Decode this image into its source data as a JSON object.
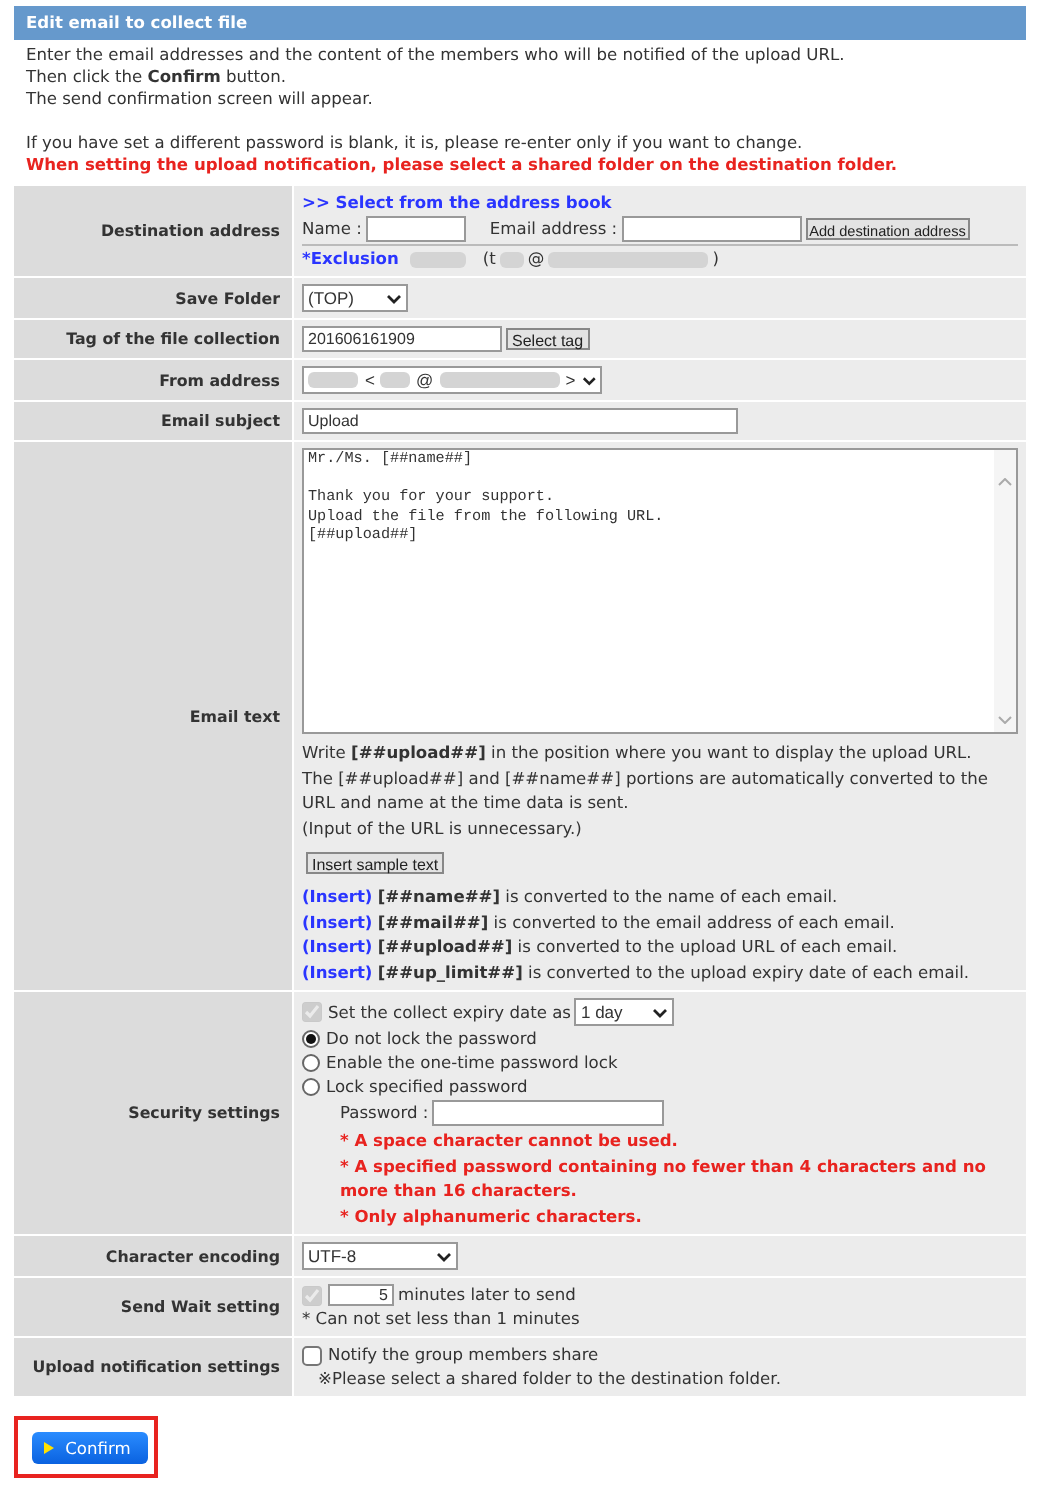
{
  "header": {
    "title": "Edit email to collect file"
  },
  "intro": {
    "lines": [
      "Enter the email addresses and the content of the members who will be notified of the upload URL.",
      "Then click the **Confirm** button.",
      "The send confirmation screen will appear."
    ],
    "note": "If you have set a different password is blank, it is, please re-enter only if you want to change.",
    "warning": "When setting the upload notification, please select a shared folder on the destination folder."
  },
  "rows": [
    {
      "kind": "destination",
      "label": "Destination address",
      "link": ">> Select from the address book",
      "name_label": "Name :",
      "email_label": "Email address :",
      "add_button": "Add destination address",
      "exclusion": {
        "label": "*Exclusion",
        "open": "(t",
        "at": "@",
        "close": ")"
      }
    },
    {
      "kind": "dropdown",
      "label": "Save Folder",
      "value": "(TOP)"
    },
    {
      "kind": "tag",
      "label": "Tag of the file collection",
      "value": "201606161909",
      "button": "Select tag"
    },
    {
      "kind": "from",
      "label": "From address",
      "open": "<",
      "at": "@",
      "close": ">"
    },
    {
      "kind": "text",
      "label": "Email subject",
      "value": "Upload"
    },
    {
      "kind": "email_text",
      "label": "Email text",
      "body": "Mr./Ms. [##name##]\n\nThank you for your support.\nUpload the file from the following URL.\n[##upload##]",
      "hints": [
        "Write **[##upload##]** in the position where you want to display the upload URL.",
        "The [##upload##] and [##name##] portions are automatically converted to the URL and name at the time data is sent.",
        "(Input of the URL is unnecessary.)"
      ],
      "insert_button": "Insert sample text",
      "inserts": [
        {
          "link": "(Insert)",
          "text": "**[##name##]** is converted to the name of each email."
        },
        {
          "link": "(Insert)",
          "text": "**[##mail##]** is converted to the email address of each email."
        },
        {
          "link": "(Insert)",
          "text": "**[##upload##]** is converted to the upload URL of each email."
        },
        {
          "link": "(Insert)",
          "text": "**[##up_limit##]** is converted to the upload expiry date of each email."
        }
      ]
    },
    {
      "kind": "security",
      "label": "Security settings",
      "expiry": {
        "checked": true,
        "disabled": true,
        "label": "Set the collect expiry date as",
        "value": "1 day"
      },
      "radios": [
        {
          "label": "Do not lock the password",
          "selected": true
        },
        {
          "label": "Enable the one-time password lock",
          "selected": false
        },
        {
          "label": "Lock specified password",
          "selected": false
        }
      ],
      "password_label": "Password :",
      "warnings": [
        "* A space character cannot be used.",
        "* A specified password containing no fewer than 4 characters and no more than 16 characters.",
        "* Only alphanumeric characters."
      ]
    },
    {
      "kind": "dropdown",
      "label": "Character encoding",
      "value": "UTF-8"
    },
    {
      "kind": "send_wait",
      "label": "Send Wait setting",
      "checked": true,
      "disabled": true,
      "value": "5",
      "suffix": "minutes later to send",
      "note": "* Can not set less than 1 minutes"
    },
    {
      "kind": "notify",
      "label": "Upload notification settings",
      "checked": false,
      "checkbox_label": "Notify the group members share",
      "note": "※Please select a shared folder to the destination folder."
    }
  ],
  "confirm_button": "Confirm"
}
